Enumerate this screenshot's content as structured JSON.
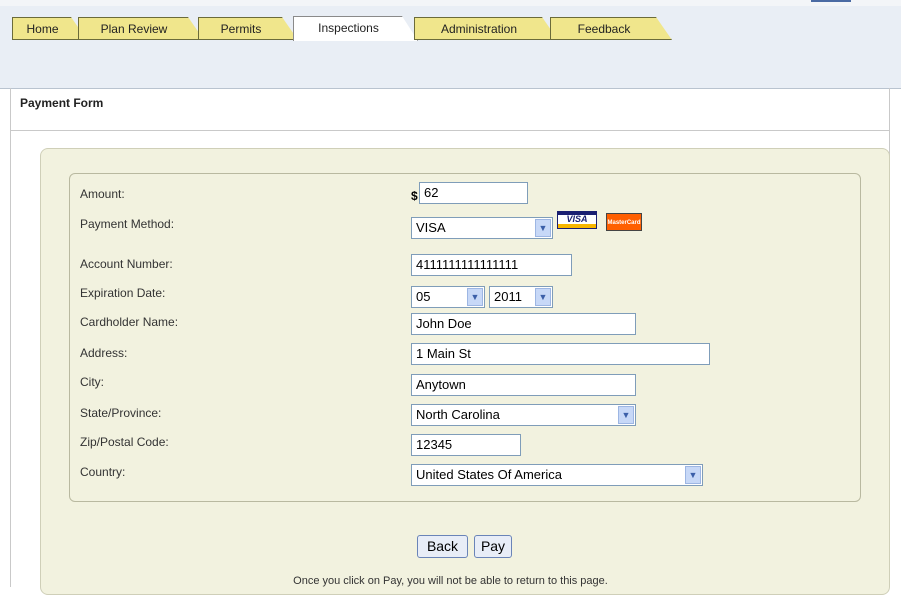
{
  "tabs": [
    {
      "label": "Home"
    },
    {
      "label": "Plan Review"
    },
    {
      "label": "Permits"
    },
    {
      "label": "Inspections"
    },
    {
      "label": "Administration"
    },
    {
      "label": "Feedback"
    }
  ],
  "active_tab": "Inspections",
  "section_title": "Payment Form",
  "form": {
    "amount": {
      "label": "Amount:",
      "currency": "$",
      "value": "62"
    },
    "payment_method": {
      "label": "Payment Method:",
      "value": "VISA",
      "cards": [
        "VISA",
        "MasterCard"
      ]
    },
    "account_number": {
      "label": "Account Number:",
      "value": "4111111111111111"
    },
    "expiration": {
      "label": "Expiration Date:",
      "month": "05",
      "year": "2011"
    },
    "cardholder": {
      "label": "Cardholder Name:",
      "value": "John Doe"
    },
    "address": {
      "label": "Address:",
      "value": "1 Main St"
    },
    "city": {
      "label": "City:",
      "value": "Anytown"
    },
    "state": {
      "label": "State/Province:",
      "value": "North Carolina"
    },
    "zip": {
      "label": "Zip/Postal Code:",
      "value": "12345"
    },
    "country": {
      "label": "Country:",
      "value": "United States Of America"
    }
  },
  "buttons": {
    "back": "Back",
    "pay": "Pay"
  },
  "notice": "Once you click on Pay, you will not be able to return to this page.",
  "colors": {
    "tab_inactive": "#f0e68c",
    "panel": "#f2f2df",
    "topbar": "#e9eef5"
  }
}
